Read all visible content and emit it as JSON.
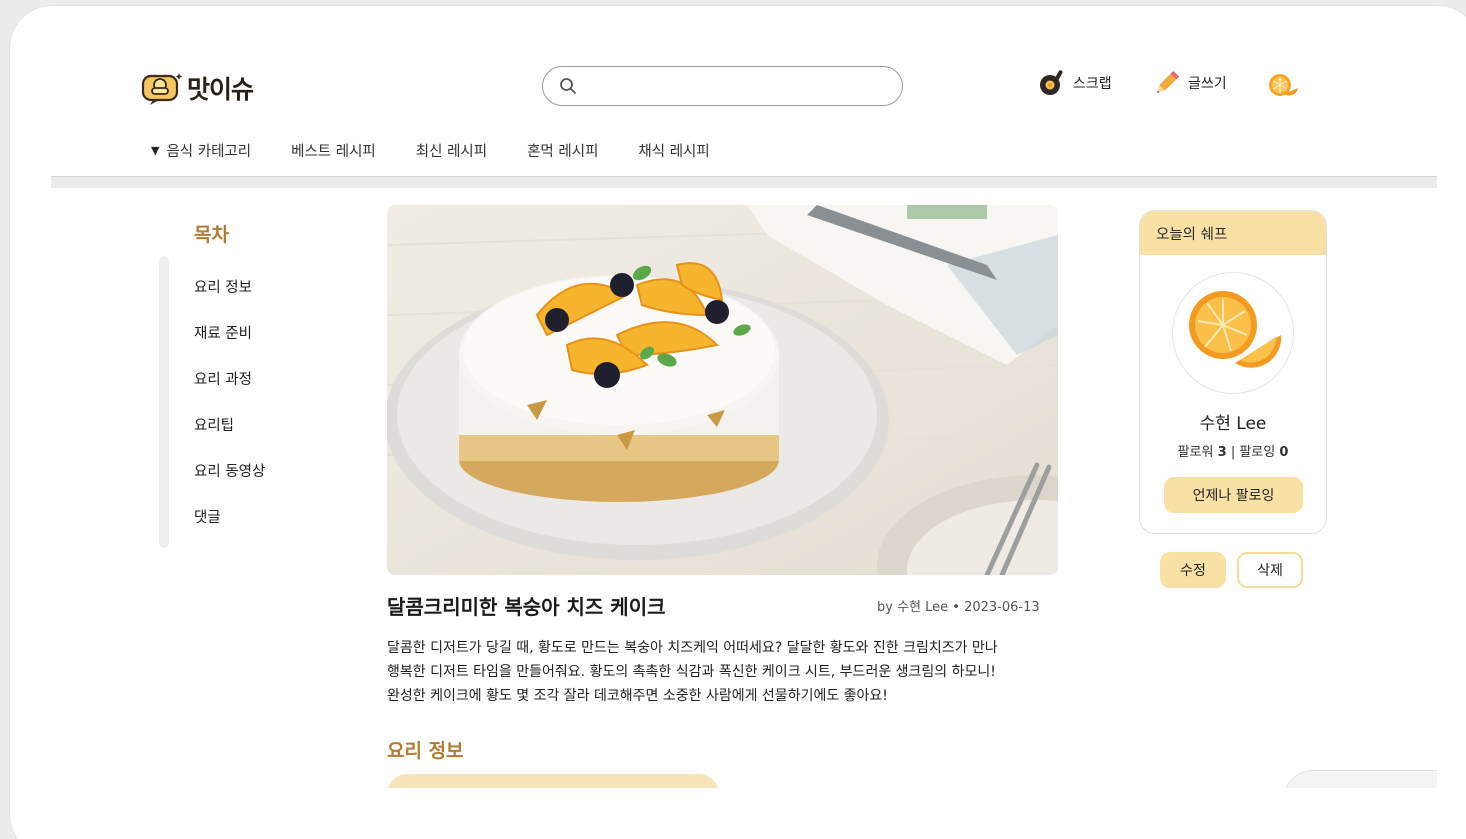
{
  "app": {
    "logo_text": "맛이슈"
  },
  "header": {
    "search_placeholder": "",
    "scrap_label": "스크랩",
    "write_label": "글쓰기"
  },
  "nav": {
    "category_label": "음식 카테고리",
    "items": [
      "베스트 레시피",
      "최신 레시피",
      "혼먹 레시피",
      "채식 레시피"
    ]
  },
  "toc": {
    "title": "목차",
    "items": [
      "요리 정보",
      "재료 준비",
      "요리 과정",
      "요리팁",
      "요리 동영상",
      "댓글"
    ]
  },
  "recipe": {
    "title": "달콤크리미한 복숭아 치즈 케이크",
    "byline": "by 수현 Lee • 2023-06-13",
    "description": [
      "달콤한 디저트가 당길 때, 황도로 만드는 복숭아 치즈케익 어떠세요? 달달한 황도와 진한 크림치즈가 만나",
      "행복한 디저트 타임을 만들어줘요. 황도의 촉촉한 식감과 폭신한 케이크 시트, 부드러운 생크림의 하모니!",
      "완성한 케이크에 황도 몇 조각 잘라 데코해주면 소중한 사람에게 선물하기에도 좋아요!"
    ],
    "info_section_title": "요리 정보"
  },
  "chef": {
    "card_title": "오늘의 쉐프",
    "name": "수현 Lee",
    "followers_label": "팔로워",
    "followers": "3",
    "following_label": "팔로잉",
    "following": "0",
    "follow_button": "언제나 팔로잉"
  },
  "actions": {
    "edit": "수정",
    "delete": "삭제"
  },
  "colors": {
    "accent": "#b07c32",
    "highlight": "#f9e1a6"
  }
}
